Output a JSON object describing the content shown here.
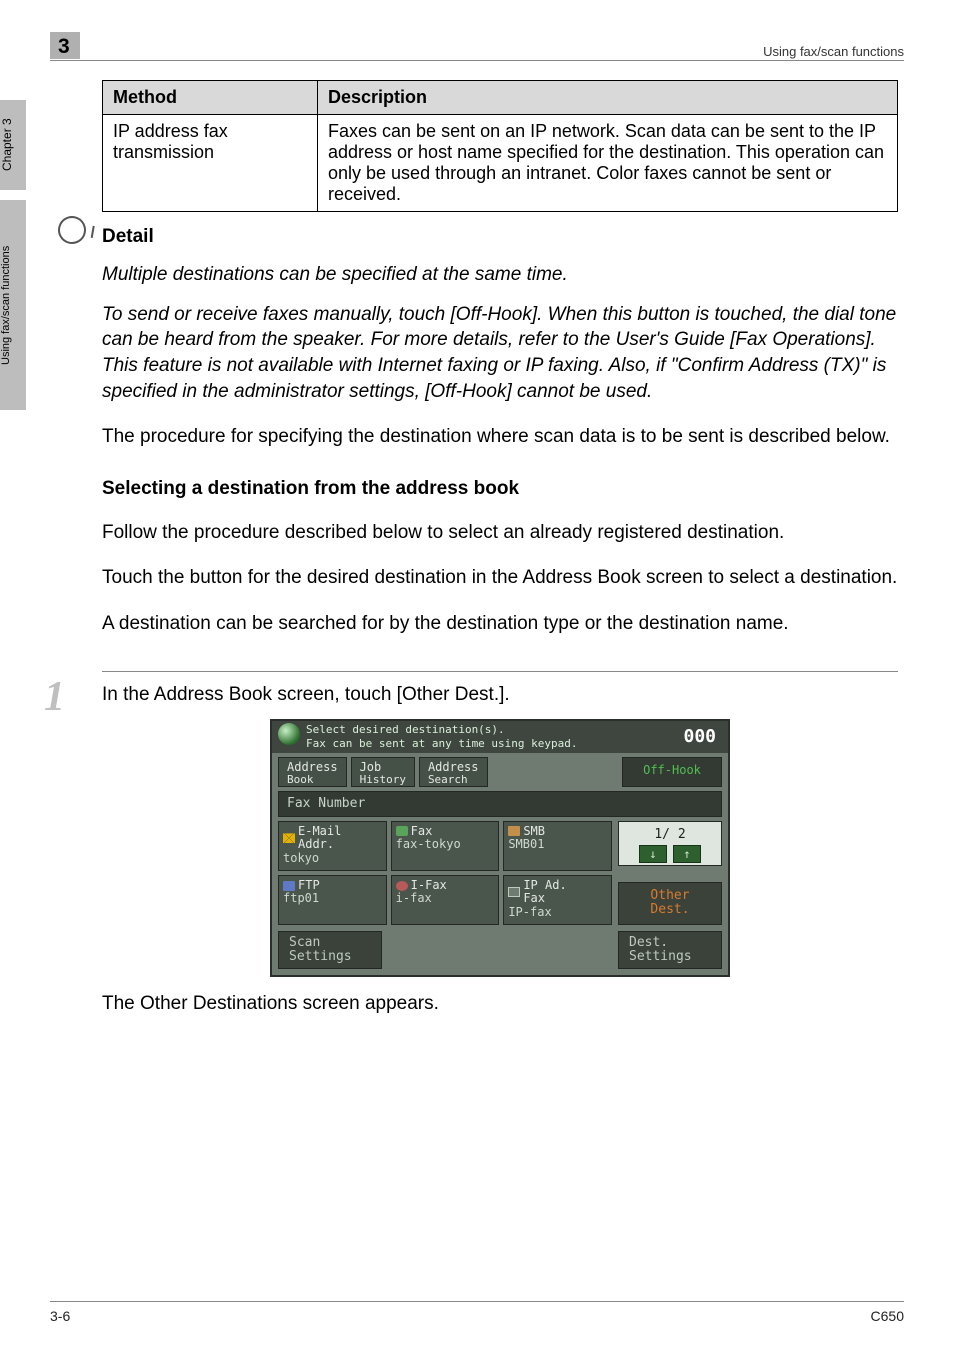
{
  "header": {
    "chapter_number": "3",
    "running_title": "Using fax/scan functions"
  },
  "side_tabs": {
    "chapter": "Chapter 3",
    "section": "Using fax/scan functions"
  },
  "table": {
    "headers": {
      "method": "Method",
      "description": "Description"
    },
    "rows": [
      {
        "method": "IP address fax transmission",
        "description": "Faxes can be sent on an IP network. Scan data can be sent to the IP address or host name specified for the destination. This operation can only be used through an intranet. Color faxes cannot be sent or received."
      }
    ]
  },
  "detail": {
    "title": "Detail",
    "p1": "Multiple destinations can be specified at the same time.",
    "p2": "To send or receive faxes manually, touch [Off-Hook]. When this button is touched, the dial tone can be heard from the speaker. For more details, refer to the User's Guide [Fax Operations]. This feature is not available with Internet faxing or IP faxing. Also, if \"Confirm Address (TX)\" is specified in the administrator settings, [Off-Hook] cannot be used."
  },
  "body_after_detail": "The procedure for specifying the destination where scan data is to be sent is described below.",
  "section_heading": "Selecting a destination from the address book",
  "section_paras": {
    "p1": "Follow the procedure described below to select an already registered destination.",
    "p2": "Touch the button for the desired destination in the Address Book screen to select a destination.",
    "p3": "A destination can be searched for by the destination type or the destination name."
  },
  "step": {
    "number": "1",
    "text": "In the Address Book screen, touch [Other Dest.].",
    "caption": "The Other Destinations screen appears."
  },
  "device": {
    "header": {
      "line1": "Select desired destination(s).",
      "line2": "Fax can be sent at any time using keypad.",
      "count": "000"
    },
    "tabs": {
      "address_book_l1": "Address",
      "address_book_l2": "Book",
      "job_history_l1": "Job",
      "job_history_l2": "History",
      "address_search_l1": "Address",
      "address_search_l2": "Search",
      "off_hook": "Off-Hook"
    },
    "subbar": "Fax Number",
    "destinations": [
      {
        "type_l1": "E-Mail",
        "type_l2": "Addr.",
        "value": "tokyo",
        "glyph": "mail"
      },
      {
        "type_l1": "Fax",
        "type_l2": "",
        "value": "fax-tokyo",
        "glyph": "fax"
      },
      {
        "type_l1": "SMB",
        "type_l2": "",
        "value": "SMB01",
        "glyph": "smb"
      },
      {
        "type_l1": "FTP",
        "type_l2": "",
        "value": "ftp01",
        "glyph": "ftp"
      },
      {
        "type_l1": "I-Fax",
        "type_l2": "",
        "value": "i-fax",
        "glyph": "ifax"
      },
      {
        "type_l1": "IP Ad.",
        "type_l2": "Fax",
        "value": "IP-fax",
        "glyph": "ipad"
      }
    ],
    "pager": {
      "label": "1/  2",
      "down": "↓",
      "up": "↑"
    },
    "other_dest_l1": "Other",
    "other_dest_l2": "Dest.",
    "scan_settings_l1": "Scan",
    "scan_settings_l2": "Settings",
    "dest_settings_l1": "Dest.",
    "dest_settings_l2": "Settings"
  },
  "footer": {
    "left": "3-6",
    "right": "C650"
  }
}
